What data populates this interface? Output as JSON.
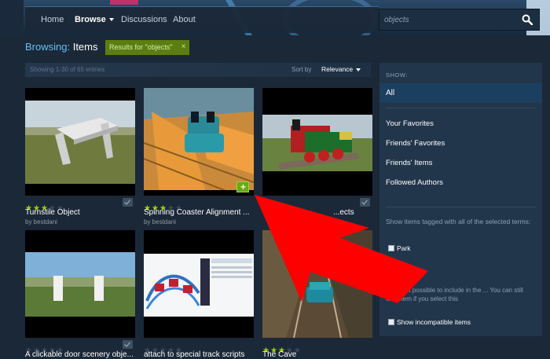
{
  "nav": {
    "items": [
      {
        "label": "Home",
        "active": false
      },
      {
        "label": "Browse",
        "active": true
      },
      {
        "label": "Discussions",
        "active": false
      },
      {
        "label": "About",
        "active": false
      }
    ],
    "search_value": "objects"
  },
  "heading": {
    "label": "Browsing:",
    "value": "Items",
    "results_tag": "Results for \"objects\"",
    "remove_glyph": "×"
  },
  "list": {
    "showing": "Showing 1-30 of 65 entries",
    "sort_label": "Sort by",
    "sort_value": "Relevance"
  },
  "items": [
    {
      "title": "Turnstile Object",
      "author": "by bestdani",
      "stars": 3,
      "rated": true,
      "thumb_scene": "turnstile"
    },
    {
      "title": "Spinning Coaster Alignment ...",
      "author": "by bestdani",
      "stars": 3,
      "rated": true,
      "thumb_scene": "coaster"
    },
    {
      "title": "...ects",
      "author": "",
      "stars": 0,
      "rated": true,
      "thumb_scene": "train"
    },
    {
      "title": "A clickable door scenery obje...",
      "author": "",
      "stars": 0,
      "rated": true,
      "thumb_scene": "doors"
    },
    {
      "title": "attach to special track scripts",
      "author": "",
      "stars": 0,
      "rated": false,
      "thumb_scene": "editor"
    },
    {
      "title": "The Cave",
      "author": "",
      "stars": 3,
      "rated": false,
      "thumb_scene": "cave"
    }
  ],
  "sidebar": {
    "show_label": "SHOW:",
    "filters": [
      "All",
      "Your Favorites",
      "Friends' Favorites",
      "Friends' Items",
      "Followed Authors"
    ],
    "tagged_text": "Show items tagged with all of the selected terms:",
    "tags": [
      "Park"
    ],
    "incompat_note": "...are not possible to include in the ... You can still find them if you select this",
    "incompat_checkbox": "Show incompatible items"
  },
  "colors": {
    "accent": "#66c0f4",
    "star_on": "#a3cf06",
    "tag_bg": "#5c7e10",
    "annotation_arrow": "#ff0000"
  }
}
